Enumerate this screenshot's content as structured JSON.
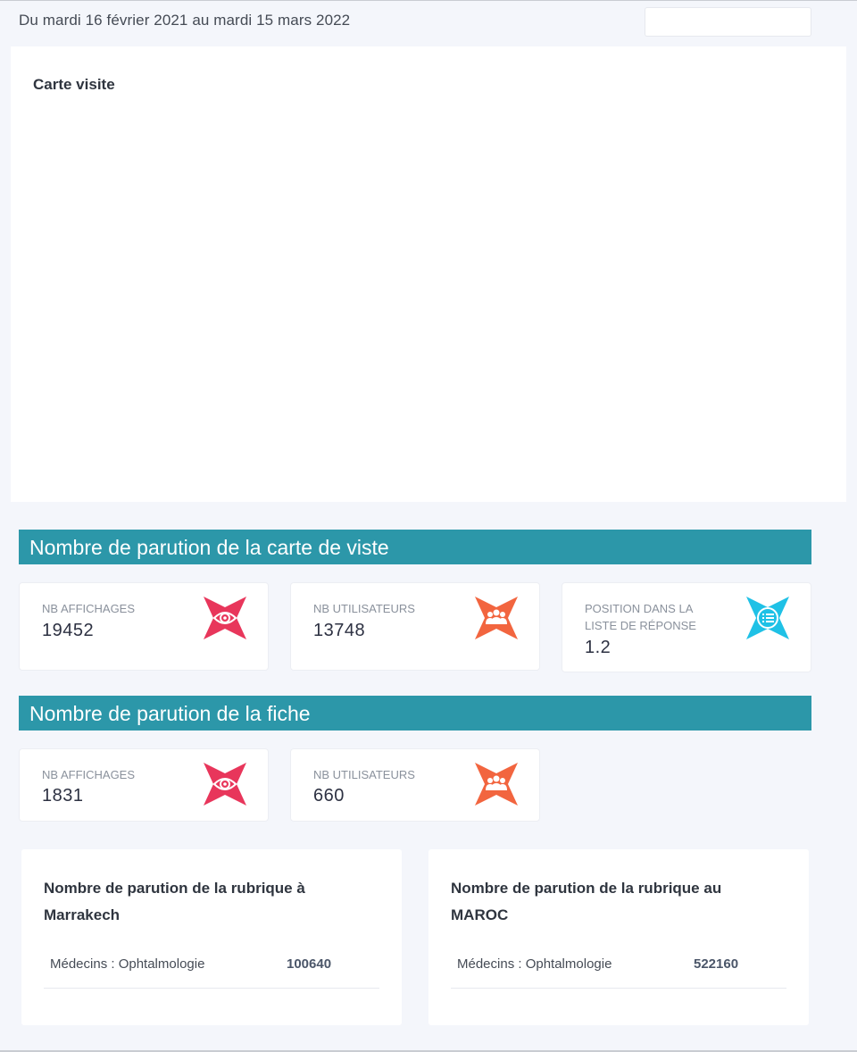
{
  "header": {
    "date_range": "Du mardi 16 février 2021 au mardi 15 mars 2022",
    "date_picker_value": ""
  },
  "map_card": {
    "title": "Carte visite"
  },
  "section_carte": {
    "title": "Nombre de parution de la carte de viste",
    "stats": [
      {
        "label": "NB AFFICHAGES",
        "value": "19452",
        "icon": "eye-icon",
        "color": "#e8365b"
      },
      {
        "label": "NB UTILISATEURS",
        "value": "13748",
        "icon": "users-icon",
        "color": "#f2653f"
      },
      {
        "label": "POSITION DANS LA LISTE DE RÉPONSE",
        "value": "1.2",
        "icon": "list-icon",
        "color": "#1fc1e6"
      }
    ]
  },
  "section_fiche": {
    "title": "Nombre de parution de la fiche",
    "stats": [
      {
        "label": "NB AFFICHAGES",
        "value": "1831",
        "icon": "eye-icon",
        "color": "#e8365b"
      },
      {
        "label": "NB UTILISATEURS",
        "value": "660",
        "icon": "users-icon",
        "color": "#f2653f"
      }
    ]
  },
  "rubriques": [
    {
      "title": "Nombre de parution de la rubrique à Marrakech",
      "category": "Médecins : Ophtalmologie",
      "count": "100640"
    },
    {
      "title": "Nombre de parution de la rubrique au MAROC",
      "category": "Médecins : Ophtalmologie",
      "count": "522160"
    }
  ],
  "colors": {
    "section_header": "#2c97a9",
    "page_bg": "#f4f6fb"
  }
}
